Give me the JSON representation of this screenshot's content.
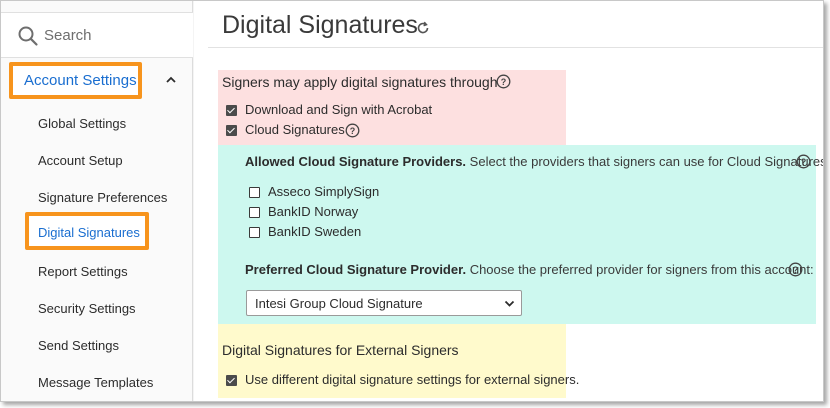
{
  "sidebar": {
    "search_placeholder": "Search",
    "section_label": "Account Settings",
    "items": [
      {
        "label": "Global Settings"
      },
      {
        "label": "Account Setup"
      },
      {
        "label": "Signature Preferences"
      },
      {
        "label": "Digital Signatures",
        "selected": true
      },
      {
        "label": "Report Settings"
      },
      {
        "label": "Security Settings"
      },
      {
        "label": "Send Settings"
      },
      {
        "label": "Message Templates"
      }
    ]
  },
  "page": {
    "title": "Digital Signatures"
  },
  "signers": {
    "heading": "Signers may apply digital signatures through",
    "options": [
      {
        "label": "Download and Sign with Acrobat",
        "checked": true
      },
      {
        "label": "Cloud Signatures",
        "checked": true
      }
    ]
  },
  "cloud": {
    "allowed_heading": "Allowed Cloud Signature Providers.",
    "allowed_desc": "Select the providers that signers can use for Cloud Signatures:",
    "providers": [
      {
        "label": "Asseco SimplySign",
        "checked": false
      },
      {
        "label": "BankID Norway",
        "checked": false
      },
      {
        "label": "BankID Sweden",
        "checked": false
      }
    ],
    "preferred_heading": "Preferred Cloud Signature Provider.",
    "preferred_desc": "Choose the preferred provider for signers from this account:",
    "preferred_value": "Intesi Group Cloud Signature"
  },
  "external": {
    "heading": "Digital Signatures for External Signers",
    "option_label": "Use different digital signature settings for external signers.",
    "option_checked": true
  },
  "colors": {
    "highlight_orange": "#f7941d",
    "link_blue": "#1a6ed0",
    "signers_bg": "#fde0e0",
    "cloud_bg": "#cdf8ef",
    "external_bg": "#fffacc"
  }
}
